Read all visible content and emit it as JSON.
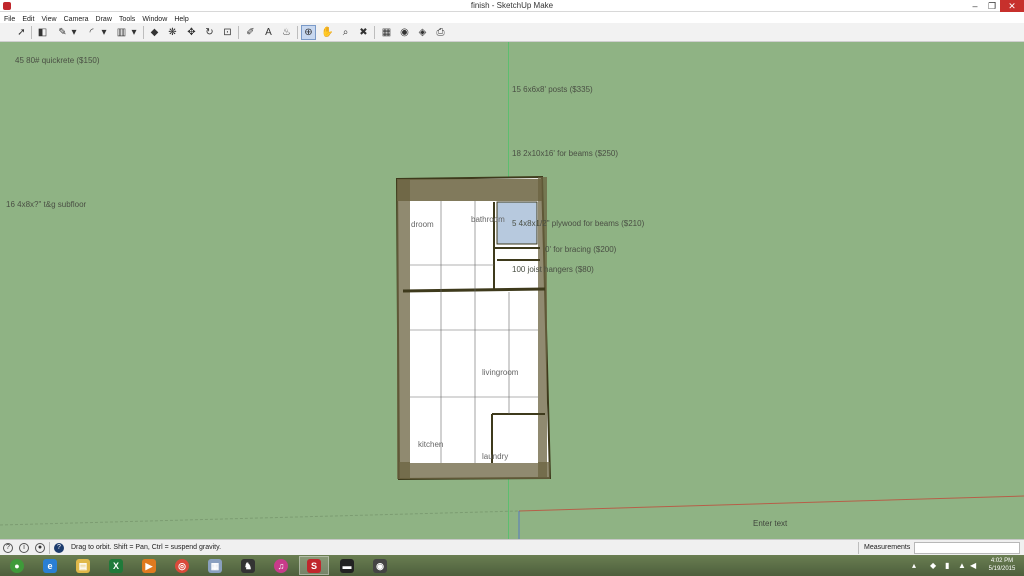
{
  "window": {
    "title": "finish - SketchUp Make",
    "minimize": "–",
    "maximize": "❐",
    "close": "✕"
  },
  "menu": [
    "File",
    "Edit",
    "View",
    "Camera",
    "Draw",
    "Tools",
    "Window",
    "Help"
  ],
  "toolbar": {
    "tools": [
      {
        "name": "select-tool",
        "glyph": "➚"
      },
      {
        "name": "eraser-tool",
        "glyph": "◧"
      },
      {
        "name": "line-tool",
        "glyph": "✎"
      },
      {
        "name": "line-dropdown",
        "glyph": "▾"
      },
      {
        "name": "arc-tool",
        "glyph": "◜"
      },
      {
        "name": "arc-dropdown",
        "glyph": "▾"
      },
      {
        "name": "rectangle-tool",
        "glyph": "▥"
      },
      {
        "name": "shape-dropdown",
        "glyph": "▾"
      },
      {
        "name": "push-pull-tool",
        "glyph": "◆"
      },
      {
        "name": "offset-tool",
        "glyph": "❋"
      },
      {
        "name": "move-tool",
        "glyph": "✥"
      },
      {
        "name": "rotate-tool",
        "glyph": "↻"
      },
      {
        "name": "scale-tool",
        "glyph": "⊡"
      },
      {
        "name": "tape-measure-tool",
        "glyph": "✐"
      },
      {
        "name": "text-tool",
        "glyph": "A"
      },
      {
        "name": "paint-bucket-tool",
        "glyph": "♨"
      },
      {
        "name": "orbit-tool",
        "glyph": "⊕"
      },
      {
        "name": "pan-tool",
        "glyph": "✋"
      },
      {
        "name": "zoom-tool",
        "glyph": "⌕"
      },
      {
        "name": "zoom-extents-tool",
        "glyph": "✖"
      },
      {
        "name": "warehouse-tool",
        "glyph": "▦"
      },
      {
        "name": "extension-warehouse-tool",
        "glyph": "◉"
      },
      {
        "name": "share-model-tool",
        "glyph": "◈"
      },
      {
        "name": "layout-tool",
        "glyph": "⎙"
      }
    ]
  },
  "viewport": {
    "labels": [
      {
        "name": "label-quickrete",
        "text": "45 80# quickrete ($150)"
      },
      {
        "name": "label-posts",
        "text": "15 6x6x8' posts ($335)"
      },
      {
        "name": "label-beams",
        "text": "18 2x10x16' for beams ($250)"
      },
      {
        "name": "label-subfloor",
        "text": "16 4x8x?\" t&g subfloor"
      },
      {
        "name": "label-plywood",
        "text": "5 4x8x1/2\" plywood for beams ($210)"
      },
      {
        "name": "label-bracing",
        "text": "0' for bracing ($200)"
      },
      {
        "name": "label-joist-hangers",
        "text": "100 joist hangers ($80)"
      },
      {
        "name": "room-bedroom",
        "text": "droom"
      },
      {
        "name": "room-bathroom",
        "text": "bathroom"
      },
      {
        "name": "room-livingroom",
        "text": "livingroom"
      },
      {
        "name": "room-kitchen",
        "text": "kitchen"
      },
      {
        "name": "room-laundry",
        "text": "laundry"
      }
    ],
    "enter_text": "Enter text"
  },
  "status": {
    "hint": "Drag to orbit. Shift = Pan, Ctrl = suspend gravity.",
    "measurements_label": "Measurements",
    "measurements_value": ""
  },
  "taskbar": {
    "apps": [
      {
        "name": "start-button",
        "glyph": "●",
        "color": "#3f9a3a"
      },
      {
        "name": "ie-app",
        "glyph": "e",
        "color": "#2a7fd4"
      },
      {
        "name": "file-explorer-app",
        "glyph": "▤",
        "color": "#e0b84a"
      },
      {
        "name": "excel-app",
        "glyph": "X",
        "color": "#1f7a3a"
      },
      {
        "name": "media-player-app",
        "glyph": "▶",
        "color": "#e07a1f"
      },
      {
        "name": "chrome-app",
        "glyph": "◎",
        "color": "#d94a3a"
      },
      {
        "name": "calculator-app",
        "glyph": "▦",
        "color": "#8aa0c0"
      },
      {
        "name": "game-app",
        "glyph": "♞",
        "color": "#333333"
      },
      {
        "name": "itunes-app",
        "glyph": "♫",
        "color": "#c83b8a"
      },
      {
        "name": "sketchup-app",
        "glyph": "S",
        "color": "#c0262c"
      },
      {
        "name": "dark-app",
        "glyph": "▬",
        "color": "#222222"
      },
      {
        "name": "camera-app",
        "glyph": "◉",
        "color": "#444444"
      }
    ],
    "clock_time": "4:02 PM",
    "clock_date": "5/19/2015"
  }
}
